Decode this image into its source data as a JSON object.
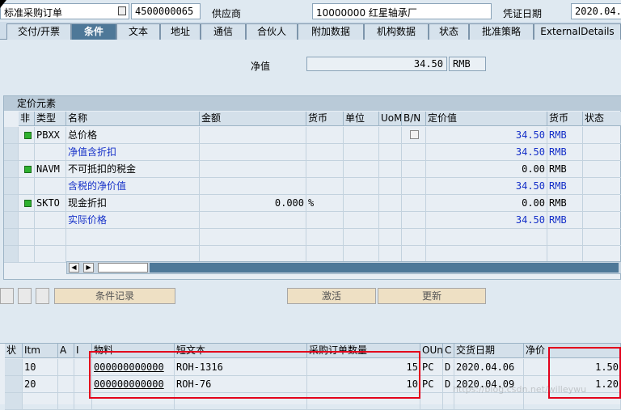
{
  "header": {
    "doc_type": "标准采购订单",
    "po_number": "4500000065",
    "vendor_label": "供应商",
    "vendor": "10000000 红星轴承厂",
    "doc_date_label": "凭证日期",
    "doc_date": "2020.04."
  },
  "tabs": [
    "交付/开票",
    "条件",
    "文本",
    "地址",
    "通信",
    "合伙人",
    "附加数据",
    "机构数据",
    "状态",
    "批准策略",
    "ExternalDetails"
  ],
  "active_tab": "条件",
  "net_value": {
    "label": "净值",
    "amount": "34.50",
    "currency": "RMB"
  },
  "pricing": {
    "title": "定价元素",
    "columns": [
      "非",
      "类型",
      "名称",
      "金额",
      "货币",
      "单位",
      "UoM",
      "B/N",
      "定价值",
      "货币",
      "状态"
    ],
    "rows": [
      {
        "type": "PBXX",
        "name": "总价格",
        "amount": "",
        "currency": "",
        "value": "34.50",
        "val_currency": "RMB",
        "subtotal": false,
        "active": true
      },
      {
        "type": "",
        "name": "净值含折扣",
        "amount": "",
        "currency": "",
        "value": "34.50",
        "val_currency": "RMB",
        "subtotal": true,
        "active": false
      },
      {
        "type": "NAVM",
        "name": "不可抵扣的税金",
        "amount": "",
        "currency": "",
        "value": "0.00",
        "val_currency": "RMB",
        "subtotal": false,
        "active": true
      },
      {
        "type": "",
        "name": "含税的净价值",
        "amount": "",
        "currency": "",
        "value": "34.50",
        "val_currency": "RMB",
        "subtotal": true,
        "active": false
      },
      {
        "type": "SKTO",
        "name": "现金折扣",
        "amount": "0.000",
        "currency": "%",
        "value": "0.00",
        "val_currency": "RMB",
        "subtotal": false,
        "active": true
      },
      {
        "type": "",
        "name": "实际价格",
        "amount": "",
        "currency": "",
        "value": "34.50",
        "val_currency": "RMB",
        "subtotal": true,
        "active": false
      }
    ]
  },
  "buttons": {
    "condition_record": "条件记录",
    "activate": "激活",
    "update": "更新"
  },
  "items": {
    "columns": [
      "状",
      "Itm",
      "A",
      "I",
      "物料",
      "短文本",
      "采购订单数量",
      "OUn",
      "C",
      "交货日期",
      "净价"
    ],
    "rows": [
      {
        "itm": "10",
        "material": "000000000000",
        "short_text": "ROH-1316",
        "qty": "15",
        "oun": "PC",
        "c": "D",
        "date": "2020.04.06",
        "price": "1.50"
      },
      {
        "itm": "20",
        "material": "000000000000",
        "short_text": "ROH-76",
        "qty": "10",
        "oun": "PC",
        "c": "D",
        "date": "2020.04.09",
        "price": "1.20"
      }
    ]
  },
  "watermark": "https://blog.csdn.net/willeywu",
  "colors": {
    "accent": "#4e7898",
    "highlight_box": "#e3001b",
    "subtotal_text": "#1530c8",
    "status_green": "#2fb12f"
  }
}
